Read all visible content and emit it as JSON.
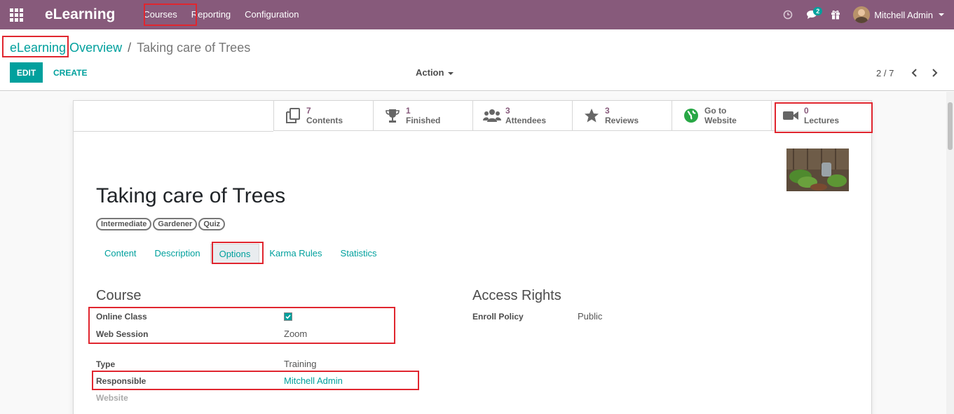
{
  "navbar": {
    "brand": "eLearning",
    "menu": [
      "Courses",
      "Reporting",
      "Configuration"
    ],
    "messages_count": "2",
    "user_name": "Mitchell Admin"
  },
  "breadcrumb": {
    "parent_a": "eLearning",
    "parent_b": "Overview",
    "current": "Taking care of Trees"
  },
  "toolbar": {
    "edit_label": "EDIT",
    "create_label": "CREATE",
    "action_label": "Action",
    "pager": "2 / 7"
  },
  "stats": [
    {
      "value": "7",
      "label": "Contents",
      "icon": "copy-icon"
    },
    {
      "value": "1",
      "label": "Finished",
      "icon": "trophy-icon"
    },
    {
      "value": "3",
      "label": "Attendees",
      "icon": "users-icon"
    },
    {
      "value": "3",
      "label": "Reviews",
      "icon": "star-icon"
    },
    {
      "value": "Go to",
      "label": "Website",
      "icon": "globe-icon"
    },
    {
      "value": "0",
      "label": "Lectures",
      "icon": "video-camera-icon"
    }
  ],
  "record": {
    "title": "Taking care of Trees",
    "tags": [
      "Intermediate",
      "Gardener",
      "Quiz"
    ]
  },
  "tabs": [
    "Content",
    "Description",
    "Options",
    "Karma Rules",
    "Statistics"
  ],
  "course_group": {
    "title": "Course",
    "online_class_label": "Online Class",
    "online_class_checked": true,
    "web_session_label": "Web Session",
    "web_session_value": "Zoom",
    "type_label": "Type",
    "type_value": "Training",
    "responsible_label": "Responsible",
    "responsible_value": "Mitchell Admin",
    "website_label": "Website"
  },
  "access_group": {
    "title": "Access Rights",
    "enroll_label": "Enroll Policy",
    "enroll_value": "Public"
  },
  "colors": {
    "navbar": "#875a7b",
    "accent": "#00a09d",
    "highlight": "#e0262f"
  }
}
